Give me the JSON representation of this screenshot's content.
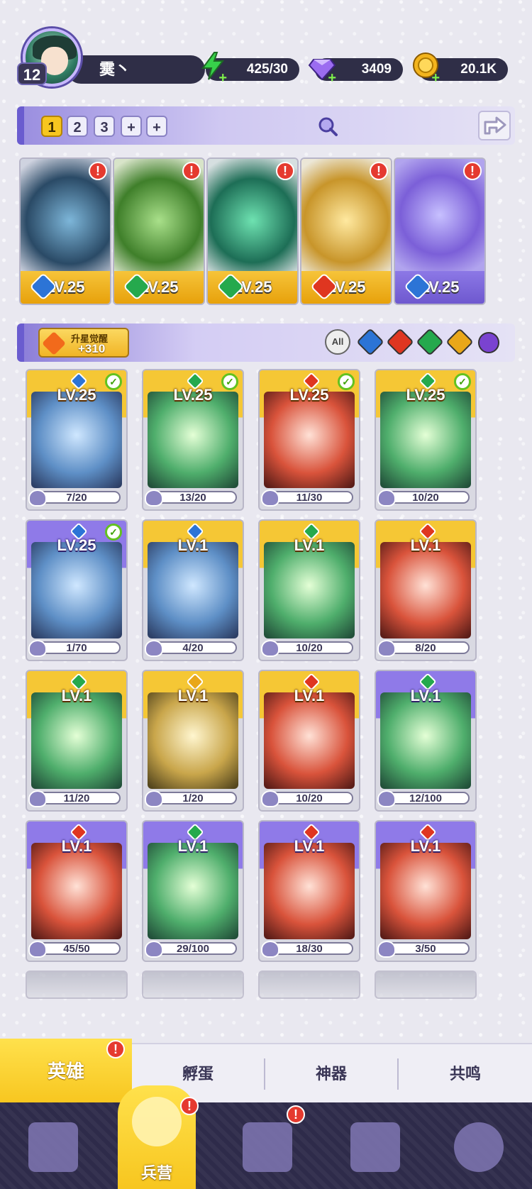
{
  "player": {
    "level": "12",
    "name": "霙丶"
  },
  "resources": [
    {
      "name": "energy",
      "value": "425/30",
      "icon": "lightning-icon",
      "color": "#37d14a"
    },
    {
      "name": "gems",
      "value": "3409",
      "icon": "gem-icon",
      "color": "#9b6cf0"
    },
    {
      "name": "gold",
      "value": "20.1K",
      "icon": "coin-icon",
      "color": "#f3b41d"
    }
  ],
  "team_tabs": [
    "1",
    "2",
    "3",
    "+",
    "+"
  ],
  "team": [
    {
      "level": "LV.25",
      "element": "water"
    },
    {
      "level": "LV.25",
      "element": "nature"
    },
    {
      "level": "LV.25",
      "element": "nature"
    },
    {
      "level": "LV.25",
      "element": "fire"
    },
    {
      "level": "LV.25",
      "element": "water"
    }
  ],
  "awaken": {
    "title": "升星觉醒",
    "value": "+310"
  },
  "filters": {
    "all_label": "All"
  },
  "heroes": [
    {
      "level": "LV.25",
      "shards": "7/20",
      "element": "water",
      "checked": true,
      "frame": "gold"
    },
    {
      "level": "LV.25",
      "shards": "13/20",
      "element": "nature",
      "checked": true,
      "frame": "gold"
    },
    {
      "level": "LV.25",
      "shards": "11/30",
      "element": "fire",
      "checked": true,
      "frame": "gold"
    },
    {
      "level": "LV.25",
      "shards": "10/20",
      "element": "nature",
      "checked": true,
      "frame": "gold"
    },
    {
      "level": "LV.25",
      "shards": "1/70",
      "element": "water",
      "checked": true,
      "frame": "purple"
    },
    {
      "level": "LV.1",
      "shards": "4/20",
      "element": "water",
      "checked": false,
      "frame": "gold"
    },
    {
      "level": "LV.1",
      "shards": "10/20",
      "element": "nature",
      "checked": false,
      "frame": "gold"
    },
    {
      "level": "LV.1",
      "shards": "8/20",
      "element": "fire",
      "checked": false,
      "frame": "gold"
    },
    {
      "level": "LV.1",
      "shards": "11/20",
      "element": "nature",
      "checked": false,
      "frame": "gold"
    },
    {
      "level": "LV.1",
      "shards": "1/20",
      "element": "light",
      "checked": false,
      "frame": "gold"
    },
    {
      "level": "LV.1",
      "shards": "10/20",
      "element": "fire",
      "checked": false,
      "frame": "gold"
    },
    {
      "level": "LV.1",
      "shards": "12/100",
      "element": "nature",
      "checked": false,
      "frame": "purple"
    },
    {
      "level": "LV.1",
      "shards": "45/50",
      "element": "fire",
      "checked": false,
      "frame": "purple"
    },
    {
      "level": "LV.1",
      "shards": "29/100",
      "element": "nature",
      "checked": false,
      "frame": "purple"
    },
    {
      "level": "LV.1",
      "shards": "18/30",
      "element": "fire",
      "checked": false,
      "frame": "purple"
    },
    {
      "level": "LV.1",
      "shards": "3/50",
      "element": "fire",
      "checked": false,
      "frame": "purple"
    }
  ],
  "subtabs": [
    "英雄",
    "孵蛋",
    "神器",
    "共鸣"
  ],
  "nav": {
    "active_label": "兵营"
  },
  "colors": {
    "gold_frame": "#f5c735",
    "purple_frame": "#8f7ae8",
    "alert": "#e53a2f",
    "nav_bg": "#2e2b4a"
  }
}
